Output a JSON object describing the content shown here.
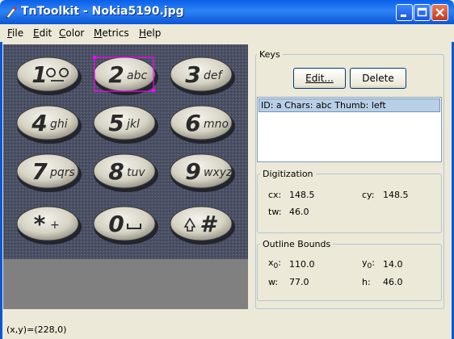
{
  "window": {
    "title": "TnToolkit - Nokia5190.jpg"
  },
  "menu": [
    {
      "underline": "F",
      "rest": "ile"
    },
    {
      "underline": "E",
      "rest": "dit"
    },
    {
      "underline": "C",
      "rest": "olor"
    },
    {
      "underline": "M",
      "rest": "etrics"
    },
    {
      "underline": "H",
      "rest": "elp"
    }
  ],
  "keys": {
    "legend": "Keys",
    "edit_button": "Edit...",
    "delete_button": "Delete",
    "selected_item": "ID: a Chars: abc Thumb: left"
  },
  "phone_keys": [
    {
      "digit": "1",
      "letters": ""
    },
    {
      "digit": "2",
      "letters": "abc"
    },
    {
      "digit": "3",
      "letters": "def"
    },
    {
      "digit": "4",
      "letters": "ghi"
    },
    {
      "digit": "5",
      "letters": "jkl"
    },
    {
      "digit": "6",
      "letters": "mno"
    },
    {
      "digit": "7",
      "letters": "pqrs"
    },
    {
      "digit": "8",
      "letters": "tuv"
    },
    {
      "digit": "9",
      "letters": "wxyz"
    },
    {
      "digit": "*",
      "letters": "+"
    },
    {
      "digit": "0",
      "letters": ""
    },
    {
      "digit": "#",
      "letters": ""
    }
  ],
  "digitization": {
    "legend": "Digitization",
    "cx_label": "cx:",
    "cx_value": "148.5",
    "cy_label": "cy:",
    "cy_value": "148.5",
    "tw_label": "tw:",
    "tw_value": "46.0"
  },
  "outline": {
    "legend": "Outline Bounds",
    "x0_label": "x",
    "x0_sub": "0",
    "x0_value": "110.0",
    "y0_label": "y",
    "y0_sub": "0",
    "y0_value": "14.0",
    "w_label": "w:",
    "w_value": "77.0",
    "h_label": "h:",
    "h_value": "46.0"
  },
  "status": {
    "text": "(x,y)=(228,0)"
  },
  "colors": {
    "titlebar": "#0a5fe8",
    "selection_box": "#ff00ff",
    "list_selection": "#b8cfe5"
  }
}
